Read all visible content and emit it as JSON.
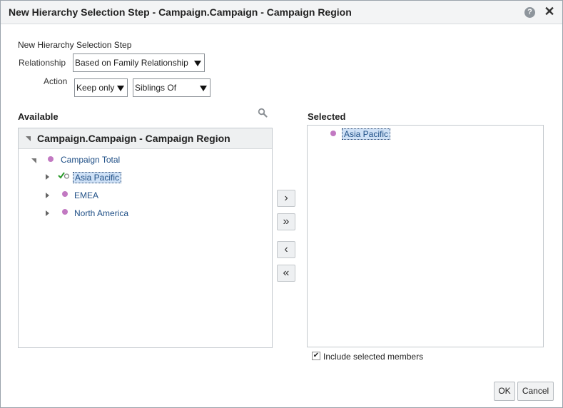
{
  "dialog": {
    "title": "New Hierarchy Selection Step - Campaign.Campaign - Campaign Region",
    "help_glyph": "?",
    "close_glyph": "✕"
  },
  "form": {
    "step_label": "New Hierarchy Selection Step",
    "relationship_label": "Relationship",
    "relationship_value": "Based on Family Relationship",
    "action_label": "Action",
    "action_value": "Keep only",
    "action_option_value": "Siblings Of"
  },
  "available": {
    "heading": "Available",
    "panel_title": "Campaign.Campaign - Campaign Region",
    "tree": {
      "root": "Campaign Total",
      "children": [
        "Asia Pacific",
        "EMEA",
        "North America"
      ]
    }
  },
  "selected": {
    "heading": "Selected",
    "items": [
      "Asia Pacific"
    ]
  },
  "move_buttons": {
    "move": "›",
    "move_all": "»",
    "remove": "‹",
    "remove_all": "«"
  },
  "include": {
    "label": "Include selected members",
    "checked_glyph": "✔"
  },
  "footer": {
    "ok": "OK",
    "cancel": "Cancel"
  },
  "colors": {
    "member_dot": "#c279c2",
    "link_text": "#1f4f86",
    "selection_bg": "#cfe1f6"
  }
}
